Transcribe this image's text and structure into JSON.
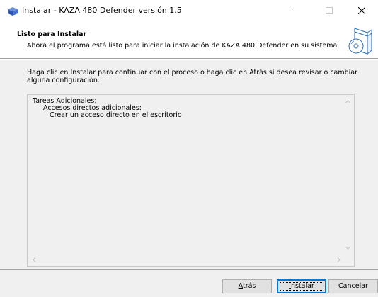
{
  "window": {
    "title": "Instalar - KAZA 480 Defender versión 1.5"
  },
  "header": {
    "title": "Listo para Instalar",
    "subtitle": "Ahora el programa está listo para iniciar la instalación de KAZA 480 Defender en su sistema."
  },
  "body": {
    "instructions": "Haga clic en Instalar para continuar con el proceso o haga clic en Atrás si desea revisar o cambiar alguna configuración.",
    "memo_lines": [
      "Tareas Adicionales:",
      "Accesos directos adicionales:",
      "Crear un acceso directo en el escritorio"
    ]
  },
  "buttons": {
    "back": {
      "mnemonic": "A",
      "rest": "trás"
    },
    "install": {
      "mnemonic": "I",
      "rest": "nstalar"
    },
    "cancel": "Cancelar"
  },
  "colors": {
    "accent": "#0078d7",
    "panel": "#f0f0f0",
    "button": "#e1e1e1"
  }
}
